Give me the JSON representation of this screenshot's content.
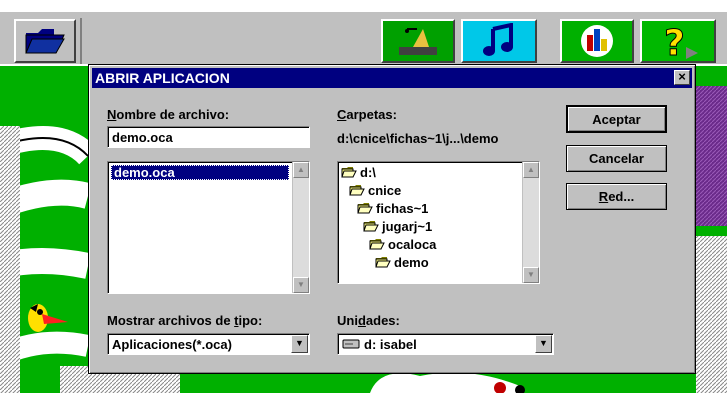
{
  "dialog": {
    "title": "ABRIR APLICACION",
    "close_label": "×",
    "filename_label_u": "N",
    "filename_label_rest": "ombre de archivo:",
    "filename_value": "demo.oca",
    "files": [
      "demo.oca"
    ],
    "folders_label_u": "C",
    "folders_label_rest": "arpetas:",
    "current_path": "d:\\cnice\\fichas~1\\j...\\demo",
    "folders": [
      {
        "name": "d:\\",
        "level": 0
      },
      {
        "name": "cnice",
        "level": 1
      },
      {
        "name": "fichas~1",
        "level": 2
      },
      {
        "name": "jugarj~1",
        "level": 3
      },
      {
        "name": "ocaloca",
        "level": 4
      },
      {
        "name": "demo",
        "level": 5
      }
    ],
    "accept_label": "Aceptar",
    "cancel_label": "Cancelar",
    "network_label_u": "R",
    "network_label_rest": "ed...",
    "type_label_pre": "Mostrar archivos de ",
    "type_label_u": "t",
    "type_label_post": "ipo:",
    "type_value": "Aplicaciones(*.oca)",
    "drive_label_pre": "Uni",
    "drive_label_u": "d",
    "drive_label_post": "ades:",
    "drive_value": "d: isabel"
  },
  "colors": {
    "titlebar": "#000080",
    "dialog_face": "#c0c0c0",
    "board_green": "#00b000",
    "music_button": "#00c8e8"
  },
  "icons": [
    "folder-icon",
    "gramophone-icon",
    "music-note-icon",
    "chart-icon",
    "help-icon",
    "drive-icon"
  ]
}
